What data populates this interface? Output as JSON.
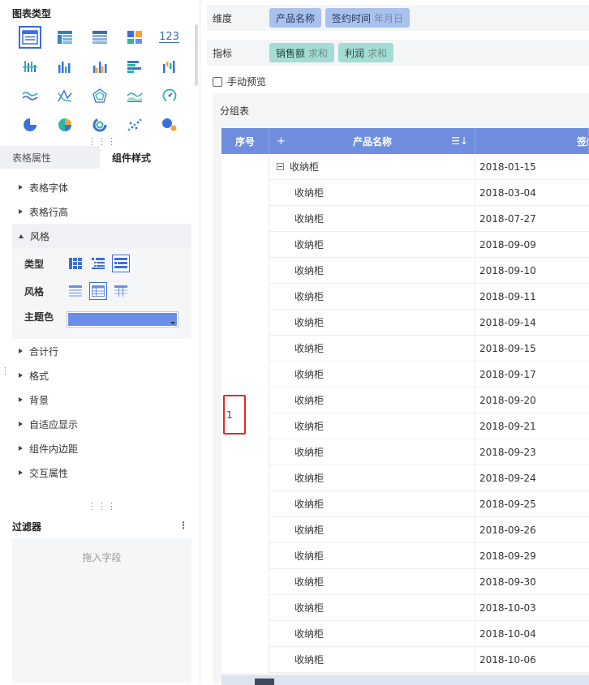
{
  "left_panel": {
    "chart_type_title": "图表类型",
    "chart_icons": [
      {
        "name": "detail-table-icon",
        "selected": true
      },
      {
        "name": "cross-table-icon"
      },
      {
        "name": "group-table-icon"
      },
      {
        "name": "dashboard-kpi-icon"
      },
      {
        "name": "number-card-icon",
        "text": "123"
      },
      {
        "name": "scatter-bar-icon"
      },
      {
        "name": "column-chart-icon"
      },
      {
        "name": "grouped-column-icon"
      },
      {
        "name": "bar-chart-icon"
      },
      {
        "name": "waterfall-icon"
      },
      {
        "name": "line-chart-icon"
      },
      {
        "name": "radar-line-icon"
      },
      {
        "name": "radar-chart-icon"
      },
      {
        "name": "area-chart-icon"
      },
      {
        "name": "gauge-icon"
      },
      {
        "name": "pie-chart-icon"
      },
      {
        "name": "multi-pie-icon"
      },
      {
        "name": "ring-chart-icon"
      },
      {
        "name": "scatter-plot-icon"
      },
      {
        "name": "bubble-chart-icon"
      }
    ],
    "tabs": {
      "table_props": "表格属性",
      "component_style": "组件样式"
    },
    "props": {
      "table_font": "表格字体",
      "table_row_height": "表格行高",
      "style": "风格",
      "total_row": "合计行",
      "format": "格式",
      "background": "背景",
      "adaptive_display": "自适应显示",
      "inner_padding": "组件内边距",
      "interaction": "交互属性"
    },
    "style_box": {
      "type_label": "类型",
      "style_label": "风格",
      "theme_color_label": "主题色",
      "theme_color": "#6b8fe8"
    },
    "filter": {
      "title": "过滤器",
      "more": "⋮",
      "placeholder": "拖入字段"
    }
  },
  "right_panel": {
    "dimension": {
      "label": "维度",
      "chips": [
        {
          "text": "产品名称",
          "sub": ""
        },
        {
          "text": "签约时间",
          "sub": "年月日"
        }
      ]
    },
    "measure": {
      "label": "指标",
      "chips": [
        {
          "text": "销售额",
          "sub": "求和"
        },
        {
          "text": "利润",
          "sub": "求和"
        }
      ]
    },
    "manual_preview": "手动预览",
    "table_title": "分组表",
    "table": {
      "headers": {
        "seq": "序号",
        "plus": "+",
        "name": "产品名称",
        "sort": "☰↓",
        "date": "签约时间"
      },
      "seq_value": "1",
      "group_name": "收纳柜",
      "rows": [
        {
          "name": "收纳柜",
          "date": "2018-01-15",
          "group": true
        },
        {
          "name": "收纳柜",
          "date": "2018-03-04"
        },
        {
          "name": "收纳柜",
          "date": "2018-07-27"
        },
        {
          "name": "收纳柜",
          "date": "2018-09-09"
        },
        {
          "name": "收纳柜",
          "date": "2018-09-10"
        },
        {
          "name": "收纳柜",
          "date": "2018-09-11"
        },
        {
          "name": "收纳柜",
          "date": "2018-09-14"
        },
        {
          "name": "收纳柜",
          "date": "2018-09-15"
        },
        {
          "name": "收纳柜",
          "date": "2018-09-17"
        },
        {
          "name": "收纳柜",
          "date": "2018-09-20"
        },
        {
          "name": "收纳柜",
          "date": "2018-09-21"
        },
        {
          "name": "收纳柜",
          "date": "2018-09-23"
        },
        {
          "name": "收纳柜",
          "date": "2018-09-24"
        },
        {
          "name": "收纳柜",
          "date": "2018-09-25"
        },
        {
          "name": "收纳柜",
          "date": "2018-09-26"
        },
        {
          "name": "收纳柜",
          "date": "2018-09-29"
        },
        {
          "name": "收纳柜",
          "date": "2018-09-30"
        },
        {
          "name": "收纳柜",
          "date": "2018-10-03"
        },
        {
          "name": "收纳柜",
          "date": "2018-10-04"
        },
        {
          "name": "收纳柜",
          "date": "2018-10-06"
        }
      ]
    }
  }
}
